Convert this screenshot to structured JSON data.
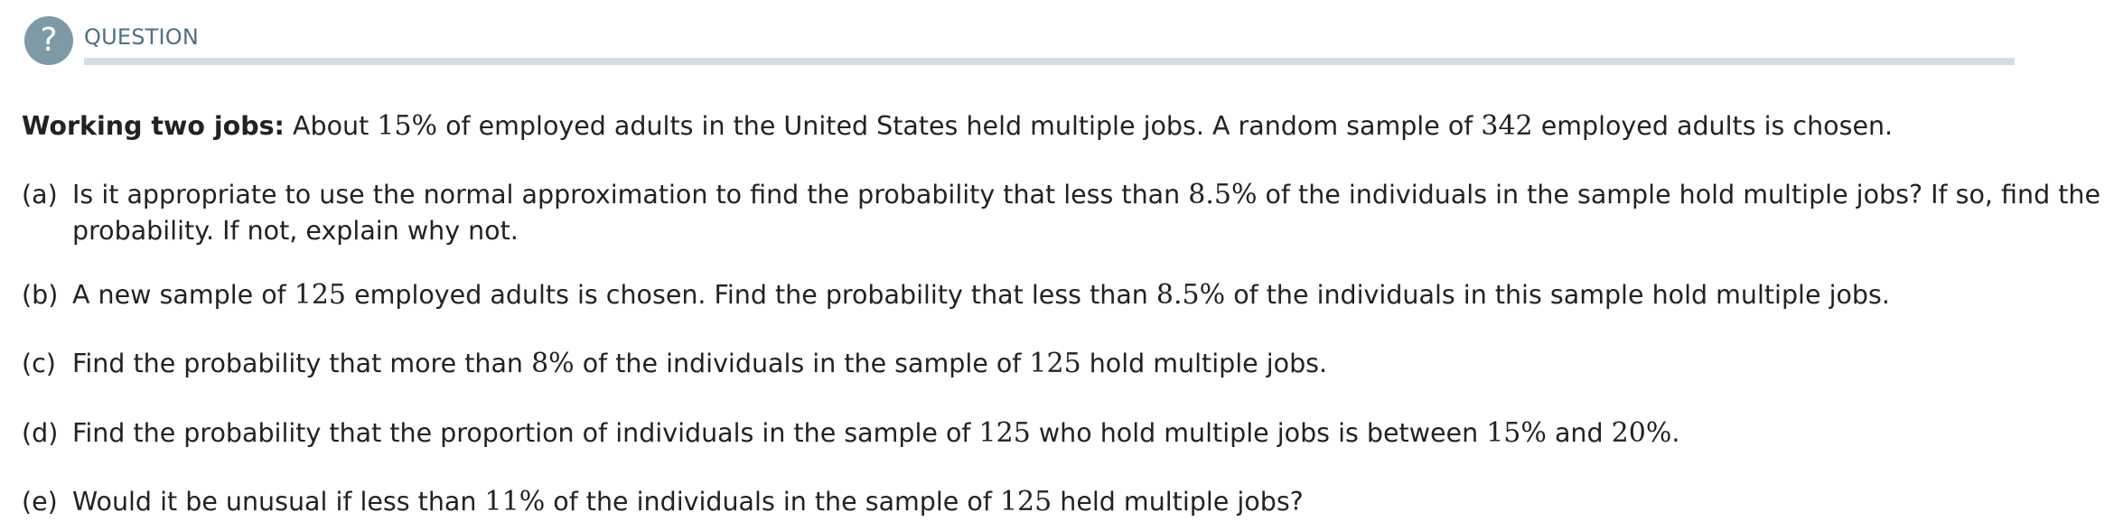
{
  "header": {
    "icon_glyph": "?",
    "icon_name": "question-icon",
    "title": "QUESTION",
    "accent_color": "#7e9aa8",
    "rule_color": "#d3dde2"
  },
  "problem": {
    "lead": "Working two jobs:",
    "intro": {
      "t1": "About",
      "n1": "15%",
      "t2": "of employed adults in the United States held multiple jobs. A random sample of",
      "n2": "342",
      "t3": "employed adults is chosen."
    },
    "parts": [
      {
        "label": "(a)",
        "t1": "Is it appropriate to use the normal approximation to find the probability that less than",
        "n1": "8.5%",
        "t2": "of the individuals in the sample hold multiple jobs? If so, find the",
        "t3": "probability. If not, explain why not."
      },
      {
        "label": "(b)",
        "t1": "A new sample of",
        "n1": "125",
        "t2": "employed adults is chosen. Find the probability that less than",
        "n2": "8.5%",
        "t3": "of the individuals in this sample hold multiple jobs."
      },
      {
        "label": "(c)",
        "t1": "Find the probability that more than",
        "n1": "8%",
        "t2": "of the individuals in the sample of",
        "n2": "125",
        "t3": "hold multiple jobs."
      },
      {
        "label": "(d)",
        "t1": "Find the probability that the proportion of individuals in the sample of",
        "n1": "125",
        "t2": "who hold multiple jobs is between",
        "n2": "15%",
        "t3": "and",
        "n3": "20%",
        "t4": "."
      },
      {
        "label": "(e)",
        "t1": "Would it be unusual if less than",
        "n1": "11%",
        "t2": "of the individuals in the sample of",
        "n2": "125",
        "t3": "held multiple jobs?"
      }
    ]
  }
}
